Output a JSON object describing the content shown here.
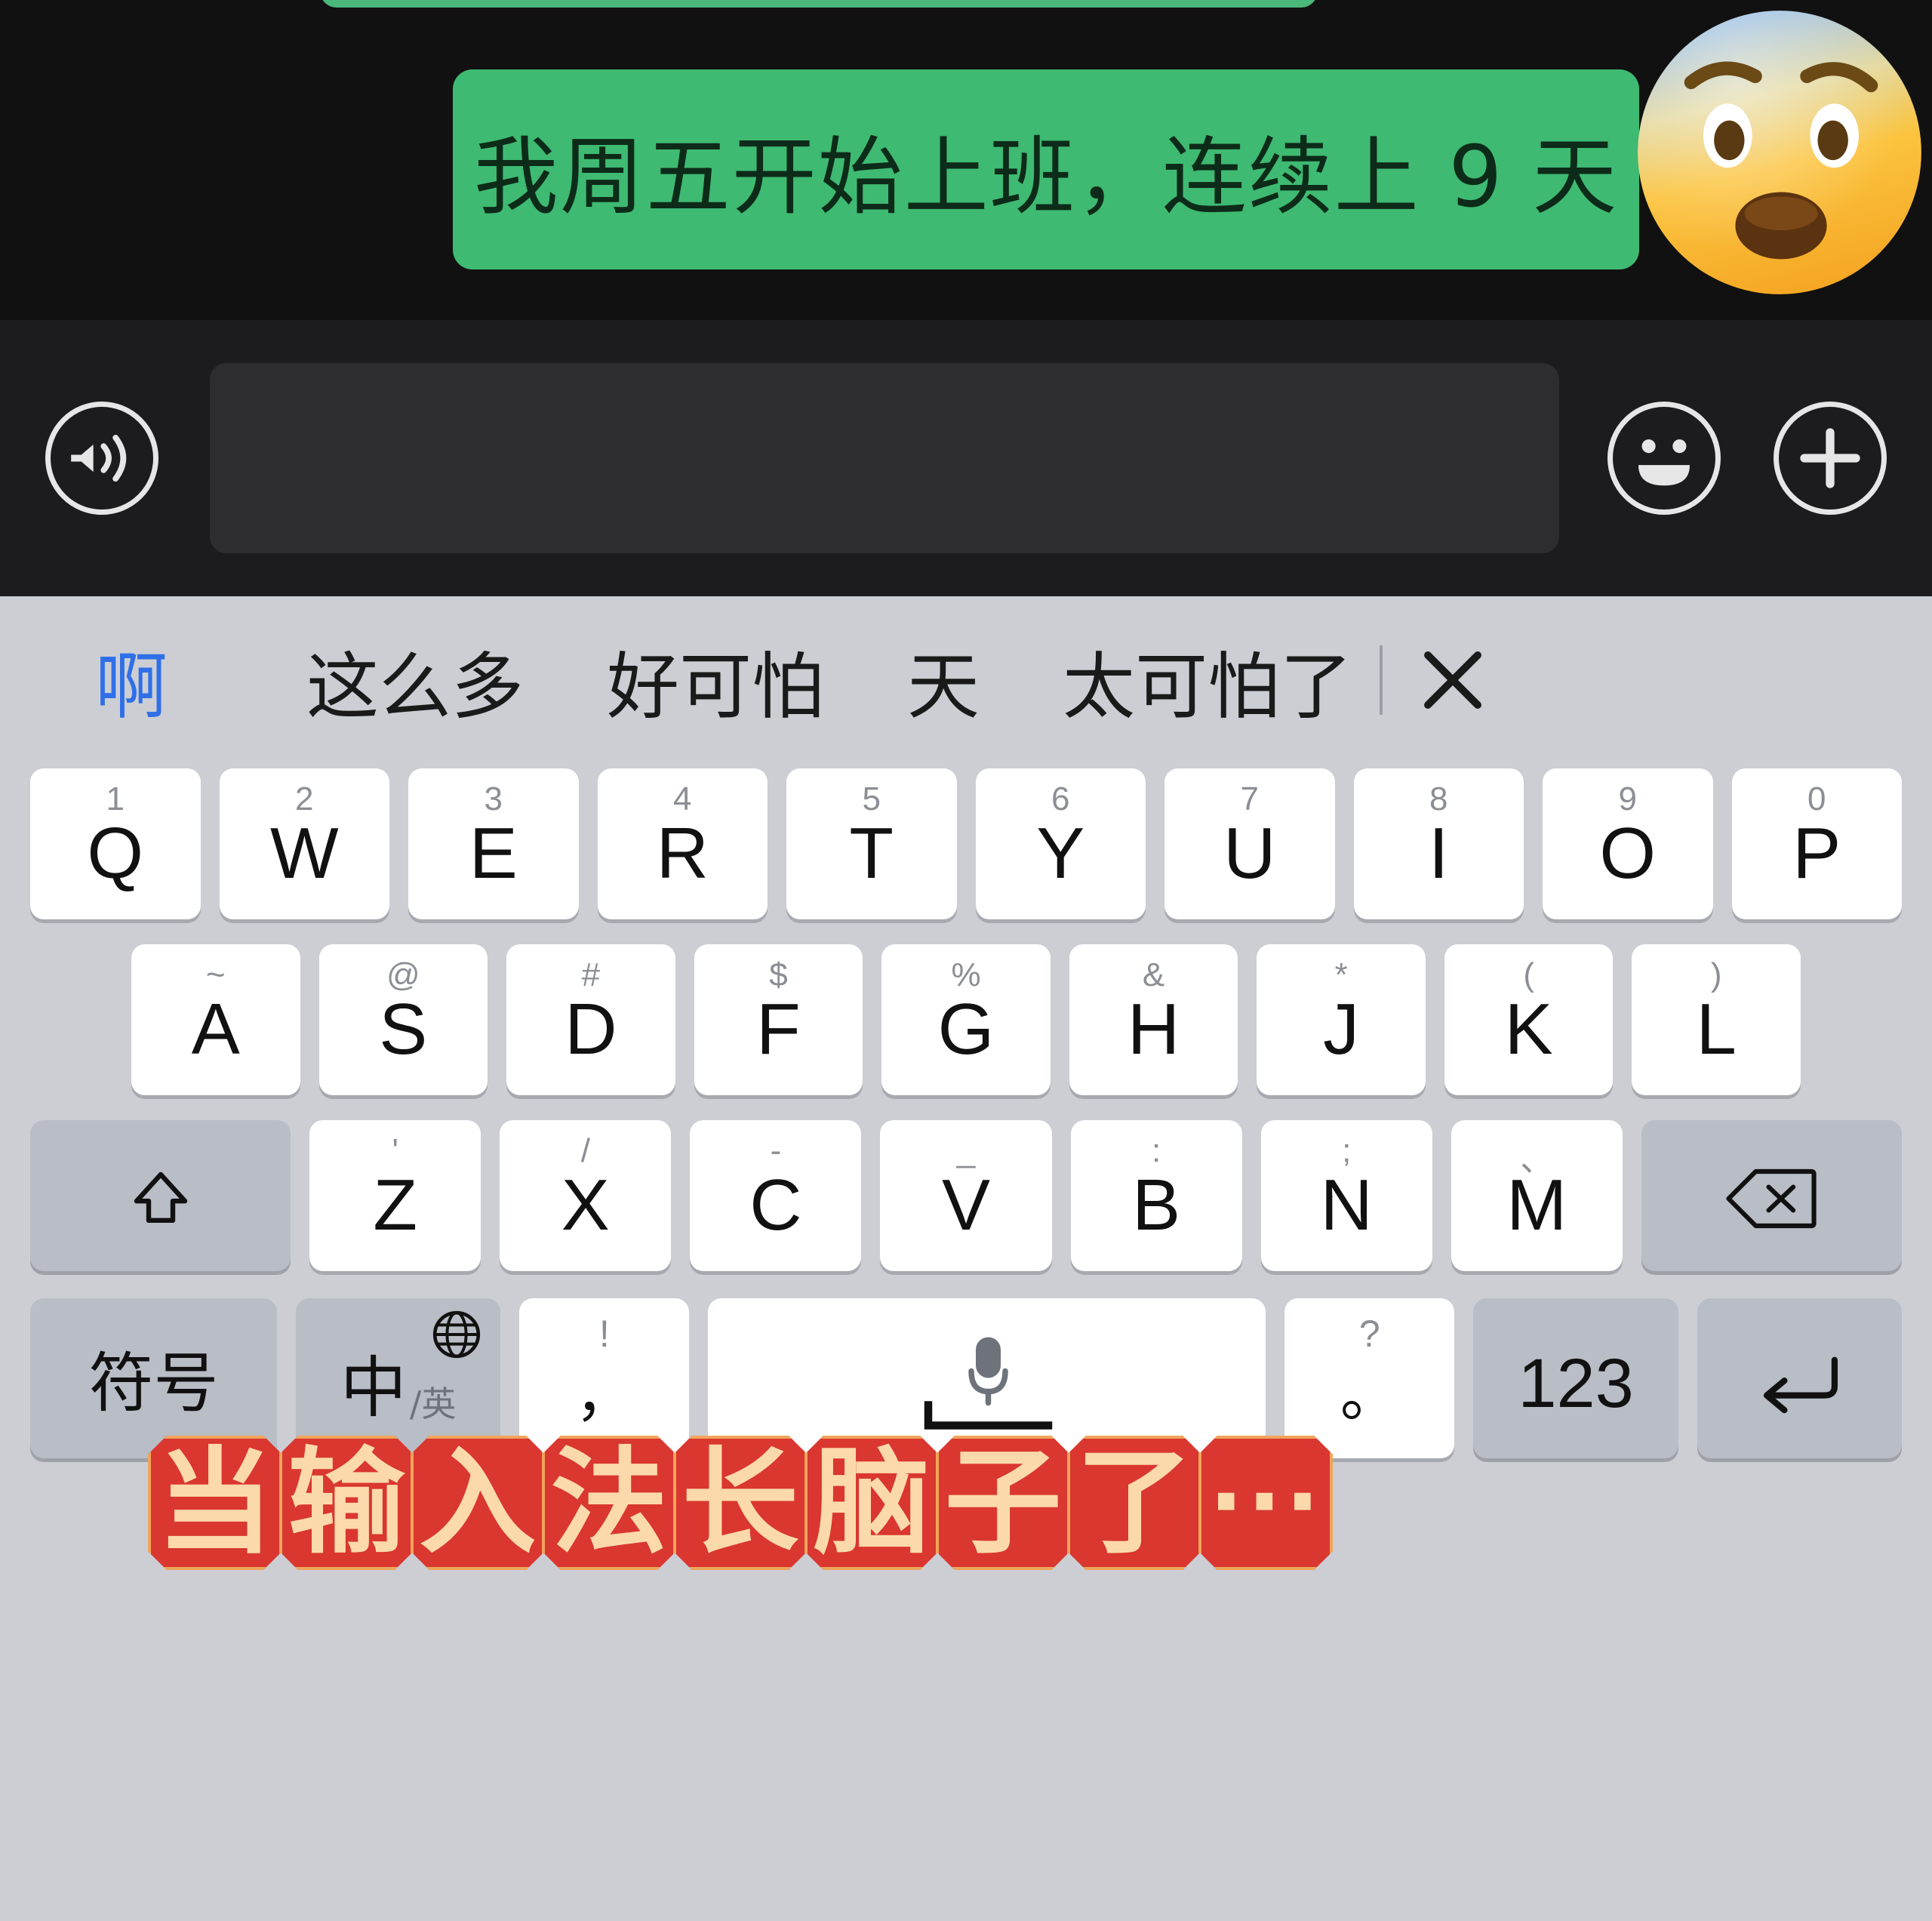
{
  "chat": {
    "message_text": "我周五开始上班，连续上 9 天",
    "bubble_color": "#3eba72",
    "background_color": "#111111",
    "emoji_name": "fearful-face-emoji"
  },
  "input_bar": {
    "voice_icon": "voice-wave-icon",
    "input_placeholder": "",
    "input_value": "",
    "emoji_icon": "smiley-face-icon",
    "plus_icon": "plus-circle-icon",
    "background_color": "#1c1c1e"
  },
  "overlay": {
    "banner_text": "当输入法长脑子了",
    "banner_chars": [
      "当",
      "输",
      "入",
      "法",
      "长",
      "脑",
      "子",
      "了"
    ],
    "banner_ellipsis": "···",
    "banner_fill_color": "#d9372f",
    "banner_border_color": "#f0a55b",
    "banner_text_color": "#fcd9ab"
  },
  "keyboard": {
    "background_color": "#ccced4",
    "candidates": [
      {
        "text": "啊",
        "active": true
      },
      {
        "text": "这么多",
        "active": false
      },
      {
        "text": "好可怕",
        "active": false
      },
      {
        "text": "天",
        "active": false
      },
      {
        "text": "太可怕了",
        "active": false
      }
    ],
    "candidate_active_color": "#2f6fe8",
    "close_icon": "close-x-icon",
    "rows": {
      "row1": [
        {
          "main": "Q",
          "sup": "1"
        },
        {
          "main": "W",
          "sup": "2"
        },
        {
          "main": "E",
          "sup": "3"
        },
        {
          "main": "R",
          "sup": "4"
        },
        {
          "main": "T",
          "sup": "5"
        },
        {
          "main": "Y",
          "sup": "6"
        },
        {
          "main": "U",
          "sup": "7"
        },
        {
          "main": "I",
          "sup": "8"
        },
        {
          "main": "O",
          "sup": "9"
        },
        {
          "main": "P",
          "sup": "0"
        }
      ],
      "row2": [
        {
          "main": "A",
          "sup": "~"
        },
        {
          "main": "S",
          "sup": "@"
        },
        {
          "main": "D",
          "sup": "#"
        },
        {
          "main": "F",
          "sup": "$"
        },
        {
          "main": "G",
          "sup": "%"
        },
        {
          "main": "H",
          "sup": "&"
        },
        {
          "main": "J",
          "sup": "*"
        },
        {
          "main": "K",
          "sup": "("
        },
        {
          "main": "L",
          "sup": ")"
        }
      ],
      "row3": [
        {
          "main": "Z",
          "sup": "'"
        },
        {
          "main": "X",
          "sup": "/"
        },
        {
          "main": "C",
          "sup": "-"
        },
        {
          "main": "V",
          "sup": "_"
        },
        {
          "main": "B",
          "sup": ":"
        },
        {
          "main": "N",
          "sup": ";"
        },
        {
          "main": "M",
          "sup": "、"
        }
      ],
      "shift_icon": "shift-up-arrow-icon",
      "backspace_icon": "backspace-delete-icon",
      "row4": {
        "symbol_key": "符号",
        "language_key_main": "中",
        "language_key_sub": "/英",
        "globe_icon": "globe-icon",
        "comma_key_main": "，",
        "comma_key_sup": "!",
        "space_icon": "microphone-icon",
        "space_underline": "space-bar-underline",
        "period_key_main": "。",
        "period_key_sup": "?",
        "number_key": "123",
        "enter_icon": "enter-return-arrow-icon"
      }
    }
  }
}
